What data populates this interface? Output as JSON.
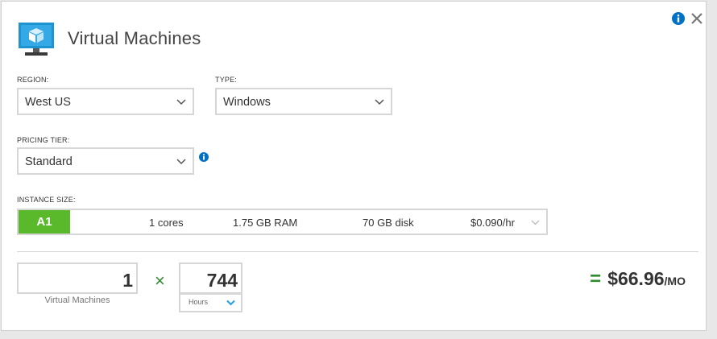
{
  "title": "Virtual Machines",
  "icons": {
    "vm": "virtual-machine-icon",
    "info": "info-icon",
    "close": "close-icon",
    "chevron": "chevron-down-icon"
  },
  "colors": {
    "accent_green": "#59b92b",
    "operator_green": "#2e8b2e",
    "info_blue": "#0072c6",
    "chevron_light_blue": "#1fa0d8"
  },
  "region": {
    "label": "REGION:",
    "value": "West US"
  },
  "type": {
    "label": "TYPE:",
    "value": "Windows"
  },
  "pricing_tier": {
    "label": "PRICING TIER:",
    "value": "Standard"
  },
  "instance_size": {
    "label": "INSTANCE SIZE:",
    "name": "A1",
    "cores": "1 cores",
    "ram": "1.75 GB RAM",
    "disk": "70 GB disk",
    "price": "$0.090/hr"
  },
  "calculator": {
    "machines_value": "1",
    "machines_label": "Virtual Machines",
    "multiply_symbol": "×",
    "hours_value": "744",
    "hours_unit": "Hours",
    "equals_symbol": "=",
    "total": "$66.96",
    "period": "/MO"
  }
}
